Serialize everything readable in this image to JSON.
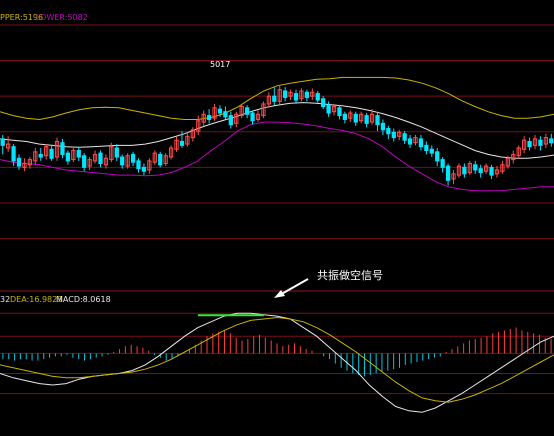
{
  "colors": {
    "background": "#000000",
    "grid": "#7a0f16",
    "frame": "#8a1a22",
    "candle_up": "#ff4d4d",
    "candle_down": "#00e5ff",
    "boll_upper": "#c8b400",
    "boll_mid": "#e8e8e8",
    "boll_lower": "#c000c0",
    "dif": "#e8e8e8",
    "dea": "#c8b400",
    "macd_pos": "#ff3c3c",
    "macd_neg": "#00c8e0",
    "highlight": "#38e838",
    "annotation": "#ffffff"
  },
  "top_panel": {
    "label_upper": "PPER:5196",
    "label_lower": "LOWER:5082",
    "peak_label": "5017"
  },
  "bottom_panel": {
    "label_prefix": "32",
    "label_dea": "DEA:16.9823",
    "label_macd": "MACD:8.0618"
  },
  "annotation": {
    "text": "共振做空信号"
  },
  "chart_data": [
    {
      "type": "candlestick",
      "title": "",
      "ylim": [
        4770,
        5150
      ],
      "y_ref_lines": [
        4800,
        4855,
        4910,
        4965,
        5020,
        5075,
        5130
      ],
      "grid": true,
      "candles": [
        [
          4954,
          4944,
          4930,
          4960
        ],
        [
          4940,
          4946,
          4934,
          4958
        ],
        [
          4942,
          4920,
          4912,
          4946
        ],
        [
          4924,
          4912,
          4906,
          4930
        ],
        [
          4910,
          4916,
          4904,
          4924
        ],
        [
          4914,
          4922,
          4908,
          4926
        ],
        [
          4920,
          4934,
          4914,
          4940
        ],
        [
          4930,
          4926,
          4920,
          4940
        ],
        [
          4928,
          4942,
          4922,
          4946
        ],
        [
          4938,
          4924,
          4920,
          4944
        ],
        [
          4926,
          4950,
          4920,
          4956
        ],
        [
          4948,
          4930,
          4924,
          4954
        ],
        [
          4932,
          4920,
          4914,
          4936
        ],
        [
          4922,
          4936,
          4918,
          4942
        ],
        [
          4936,
          4926,
          4920,
          4942
        ],
        [
          4928,
          4910,
          4904,
          4932
        ],
        [
          4912,
          4922,
          4906,
          4926
        ],
        [
          4920,
          4930,
          4916,
          4936
        ],
        [
          4932,
          4916,
          4910,
          4936
        ],
        [
          4914,
          4924,
          4908,
          4930
        ],
        [
          4922,
          4942,
          4918,
          4948
        ],
        [
          4940,
          4926,
          4920,
          4946
        ],
        [
          4926,
          4914,
          4908,
          4930
        ],
        [
          4912,
          4928,
          4908,
          4932
        ],
        [
          4930,
          4918,
          4912,
          4934
        ],
        [
          4920,
          4908,
          4902,
          4924
        ],
        [
          4910,
          4904,
          4898,
          4916
        ],
        [
          4906,
          4920,
          4900,
          4924
        ],
        [
          4918,
          4932,
          4914,
          4936
        ],
        [
          4930,
          4914,
          4910,
          4934
        ],
        [
          4916,
          4928,
          4912,
          4932
        ],
        [
          4926,
          4940,
          4922,
          4944
        ],
        [
          4938,
          4952,
          4934,
          4958
        ],
        [
          4950,
          4944,
          4940,
          4966
        ],
        [
          4946,
          4958,
          4942,
          4964
        ],
        [
          4956,
          4968,
          4950,
          4972
        ],
        [
          4966,
          4982,
          4960,
          4990
        ],
        [
          4980,
          4992,
          4974,
          4998
        ],
        [
          4990,
          4984,
          4978,
          5000
        ],
        [
          4986,
          5002,
          4982,
          5008
        ],
        [
          5000,
          4994,
          4988,
          5006
        ],
        [
          4996,
          4988,
          4984,
          5004
        ],
        [
          4990,
          4976,
          4970,
          4996
        ],
        [
          4978,
          4992,
          4972,
          4996
        ],
        [
          4990,
          5004,
          4986,
          5008
        ],
        [
          5002,
          4992,
          4986,
          5006
        ],
        [
          4994,
          4982,
          4976,
          4998
        ],
        [
          4984,
          4992,
          4980,
          4998
        ],
        [
          4990,
          5008,
          4986,
          5012
        ],
        [
          5008,
          5020,
          5002,
          5026
        ],
        [
          5020,
          5012,
          5006,
          5034
        ],
        [
          5012,
          5030,
          5008,
          5036
        ],
        [
          5028,
          5018,
          5012,
          5034
        ],
        [
          5020,
          5026,
          5014,
          5030
        ],
        [
          5024,
          5014,
          5008,
          5030
        ],
        [
          5016,
          5028,
          5012,
          5032
        ],
        [
          5026,
          5018,
          5012,
          5030
        ],
        [
          5020,
          5026,
          5014,
          5032
        ],
        [
          5024,
          5014,
          5010,
          5028
        ],
        [
          5016,
          5004,
          5000,
          5020
        ],
        [
          5006,
          4994,
          4988,
          5012
        ],
        [
          4996,
          5004,
          4990,
          5008
        ],
        [
          5002,
          4990,
          4984,
          5006
        ],
        [
          4992,
          4984,
          4978,
          4996
        ],
        [
          4986,
          4994,
          4980,
          4998
        ],
        [
          4992,
          4980,
          4974,
          4996
        ],
        [
          4982,
          4992,
          4978,
          4996
        ],
        [
          4990,
          4978,
          4972,
          4994
        ],
        [
          4980,
          4992,
          4976,
          5000
        ],
        [
          4990,
          4976,
          4966,
          4996
        ],
        [
          4978,
          4968,
          4960,
          4984
        ],
        [
          4970,
          4962,
          4954,
          4974
        ],
        [
          4964,
          4956,
          4950,
          4970
        ],
        [
          4958,
          4964,
          4952,
          4968
        ],
        [
          4962,
          4952,
          4946,
          4966
        ],
        [
          4954,
          4946,
          4940,
          4960
        ],
        [
          4948,
          4956,
          4944,
          4960
        ],
        [
          4954,
          4942,
          4936,
          4960
        ],
        [
          4944,
          4936,
          4930,
          4950
        ],
        [
          4938,
          4932,
          4926,
          4944
        ],
        [
          4934,
          4920,
          4912,
          4940
        ],
        [
          4922,
          4910,
          4902,
          4926
        ],
        [
          4912,
          4890,
          4882,
          4916
        ],
        [
          4892,
          4900,
          4884,
          4906
        ],
        [
          4898,
          4912,
          4894,
          4916
        ],
        [
          4910,
          4900,
          4894,
          4916
        ],
        [
          4902,
          4916,
          4898,
          4920
        ],
        [
          4914,
          4906,
          4900,
          4920
        ],
        [
          4908,
          4902,
          4894,
          4914
        ],
        [
          4904,
          4912,
          4900,
          4916
        ],
        [
          4910,
          4898,
          4892,
          4914
        ],
        [
          4900,
          4906,
          4894,
          4912
        ],
        [
          4904,
          4914,
          4900,
          4920
        ],
        [
          4912,
          4924,
          4908,
          4928
        ],
        [
          4922,
          4930,
          4916,
          4936
        ],
        [
          4928,
          4940,
          4924,
          4944
        ],
        [
          4938,
          4952,
          4932,
          4958
        ],
        [
          4950,
          4942,
          4936,
          4956
        ],
        [
          4944,
          4954,
          4938,
          4960
        ],
        [
          4952,
          4944,
          4936,
          4958
        ],
        [
          4946,
          4956,
          4940,
          4962
        ],
        [
          4954,
          4948,
          4942,
          4962
        ]
      ],
      "boll_upper": [
        4996,
        4990,
        4986,
        4984,
        4988,
        4994,
        4999,
        5002,
        5003,
        5002,
        4998,
        4994,
        4990,
        4986,
        4984,
        4984,
        4987,
        4993,
        5003,
        5016,
        5028,
        5036,
        5040,
        5043,
        5046,
        5047,
        5049,
        5049,
        5049,
        5049,
        5048,
        5045,
        5040,
        5033,
        5024,
        5013,
        5004,
        4996,
        4990,
        4986,
        4986,
        4988,
        4992
      ],
      "boll_mid": [
        4954,
        4952,
        4950,
        4946,
        4944,
        4942,
        4941,
        4942,
        4943,
        4944,
        4944,
        4946,
        4950,
        4956,
        4962,
        4970,
        4977,
        4983,
        4989,
        4996,
        5002,
        5006,
        5009,
        5010,
        5009,
        5007,
        5005,
        5002,
        4998,
        4993,
        4987,
        4980,
        4972,
        4963,
        4954,
        4945,
        4936,
        4930,
        4926,
        4924,
        4924,
        4926,
        4929
      ],
      "boll_lower": [
        4922,
        4918,
        4916,
        4914,
        4910,
        4906,
        4904,
        4902,
        4900,
        4898,
        4898,
        4897,
        4898,
        4902,
        4910,
        4920,
        4936,
        4950,
        4966,
        4976,
        4980,
        4980,
        4979,
        4977,
        4974,
        4970,
        4967,
        4962,
        4954,
        4942,
        4926,
        4912,
        4900,
        4888,
        4880,
        4876,
        4874,
        4874,
        4874,
        4876,
        4878,
        4880,
        4880
      ],
      "peak_label_value": 5017
    },
    {
      "type": "macd",
      "title": "",
      "ylim": [
        -45,
        40
      ],
      "y_ref_lines": [
        28,
        12,
        0,
        -14,
        -28
      ],
      "dif": [
        -14,
        -17,
        -19,
        -21,
        -22,
        -21,
        -18,
        -16,
        -15,
        -14,
        -12,
        -8,
        -2,
        5,
        12,
        18,
        22,
        26,
        28,
        28,
        27,
        26,
        24,
        18,
        12,
        4,
        -4,
        -12,
        -22,
        -30,
        -37,
        -40,
        -41,
        -38,
        -33,
        -28,
        -22,
        -16,
        -10,
        -4,
        2,
        8,
        12
      ],
      "dea": [
        -8,
        -10,
        -12,
        -14,
        -16,
        -17,
        -17,
        -16,
        -15,
        -14,
        -13,
        -11,
        -8,
        -4,
        1,
        6,
        11,
        16,
        20,
        23,
        24,
        25,
        24,
        22,
        18,
        13,
        7,
        1,
        -6,
        -13,
        -20,
        -26,
        -31,
        -33,
        -34,
        -32,
        -29,
        -25,
        -21,
        -16,
        -11,
        -6,
        -1
      ],
      "macd_bars": [
        -4,
        -4,
        -5,
        -4,
        -4,
        -5,
        -5,
        -4,
        -3,
        -2,
        -2,
        -1,
        -3,
        -4,
        -5,
        -4,
        -3,
        -2,
        -1,
        1,
        3,
        5,
        6,
        5,
        4,
        2,
        -1,
        -3,
        -5,
        -4,
        -2,
        1,
        3,
        6,
        9,
        12,
        14,
        15,
        16,
        14,
        11,
        9,
        10,
        12,
        13,
        11,
        9,
        7,
        5,
        6,
        7,
        5,
        3,
        2,
        0,
        -2,
        -4,
        -7,
        -10,
        -12,
        -14,
        -15,
        -16,
        -15,
        -14,
        -13,
        -12,
        -11,
        -10,
        -8,
        -7,
        -6,
        -5,
        -4,
        -3,
        -2,
        1,
        3,
        5,
        7,
        9,
        10,
        11,
        12,
        14,
        15,
        16,
        17,
        18,
        16,
        15,
        14,
        13,
        11,
        10
      ]
    }
  ]
}
